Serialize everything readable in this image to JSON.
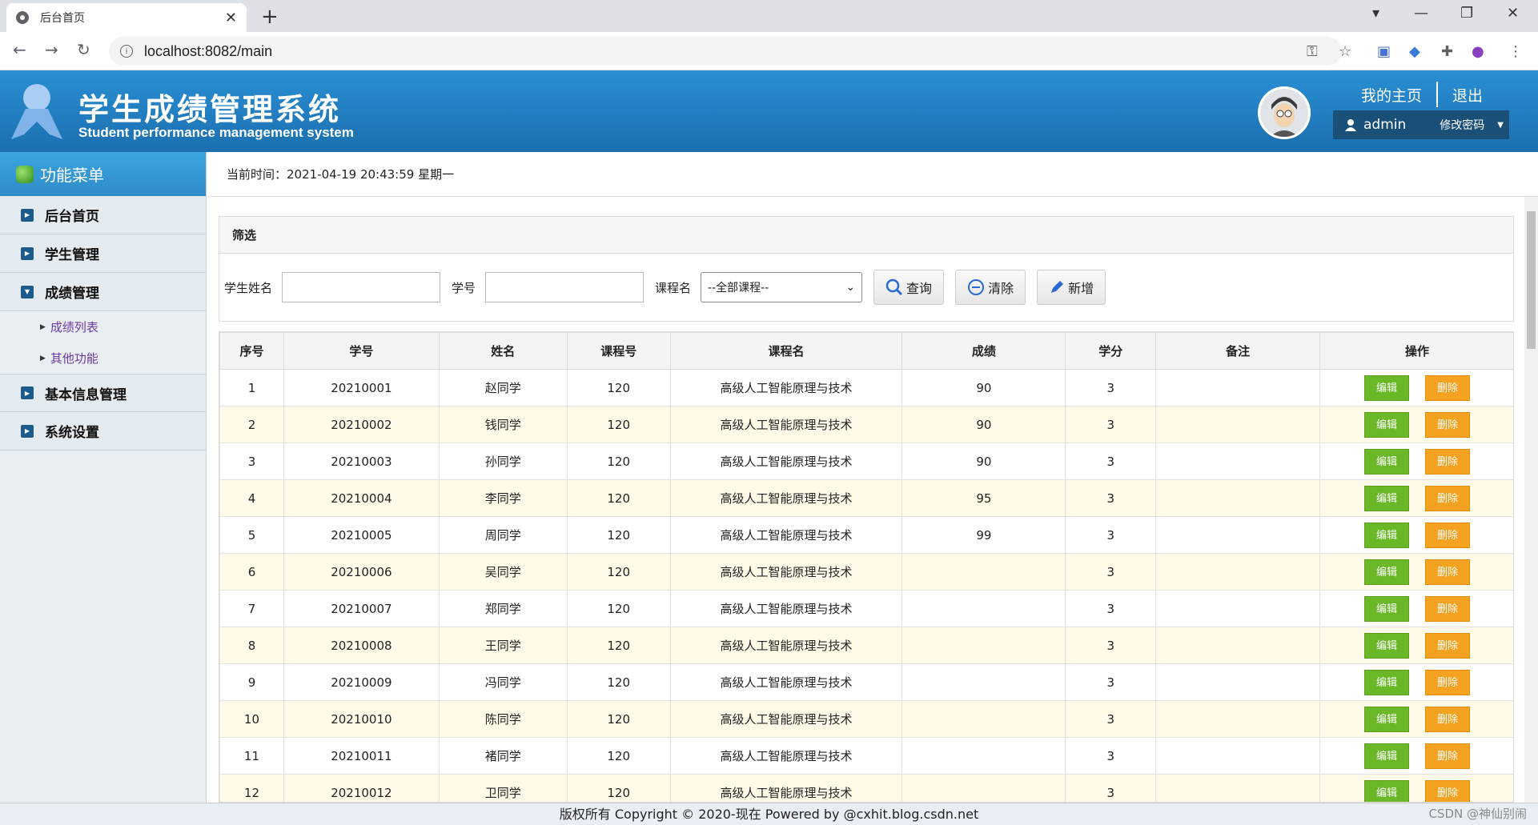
{
  "browser": {
    "tab_title": "后台首页",
    "tab_close": "✕",
    "new_tab": "+",
    "url": "localhost:8082/main"
  },
  "header": {
    "title": "学生成绩管理系统",
    "subtitle": "Student performance management system",
    "home_link": "我的主页",
    "logout_link": "退出",
    "username": "admin",
    "change_password": "修改密码"
  },
  "sidebar": {
    "menu_title": "功能菜单",
    "items": [
      {
        "label": "后台首页"
      },
      {
        "label": "学生管理"
      },
      {
        "label": "成绩管理"
      },
      {
        "label": "基本信息管理"
      },
      {
        "label": "系统设置"
      }
    ],
    "sub_items": [
      {
        "label": "成绩列表"
      },
      {
        "label": "其他功能"
      }
    ]
  },
  "main": {
    "time_label": "当前时间：2021-04-19 20:43:59 星期一",
    "filter_title": "筛选",
    "filter": {
      "name_label": "学生姓名",
      "id_label": "学号",
      "course_label": "课程名",
      "course_selected": "--全部课程--",
      "search_btn": "查询",
      "clear_btn": "清除",
      "add_btn": "新增"
    },
    "table": {
      "columns": [
        "序号",
        "学号",
        "姓名",
        "课程号",
        "课程名",
        "成绩",
        "学分",
        "备注",
        "操作"
      ],
      "edit_label": "编辑",
      "delete_label": "删除",
      "rows": [
        [
          "1",
          "20210001",
          "赵同学",
          "120",
          "高级人工智能原理与技术",
          "90",
          "3",
          ""
        ],
        [
          "2",
          "20210002",
          "钱同学",
          "120",
          "高级人工智能原理与技术",
          "90",
          "3",
          ""
        ],
        [
          "3",
          "20210003",
          "孙同学",
          "120",
          "高级人工智能原理与技术",
          "90",
          "3",
          ""
        ],
        [
          "4",
          "20210004",
          "李同学",
          "120",
          "高级人工智能原理与技术",
          "95",
          "3",
          ""
        ],
        [
          "5",
          "20210005",
          "周同学",
          "120",
          "高级人工智能原理与技术",
          "99",
          "3",
          ""
        ],
        [
          "6",
          "20210006",
          "吴同学",
          "120",
          "高级人工智能原理与技术",
          "",
          "3",
          ""
        ],
        [
          "7",
          "20210007",
          "郑同学",
          "120",
          "高级人工智能原理与技术",
          "",
          "3",
          ""
        ],
        [
          "8",
          "20210008",
          "王同学",
          "120",
          "高级人工智能原理与技术",
          "",
          "3",
          ""
        ],
        [
          "9",
          "20210009",
          "冯同学",
          "120",
          "高级人工智能原理与技术",
          "",
          "3",
          ""
        ],
        [
          "10",
          "20210010",
          "陈同学",
          "120",
          "高级人工智能原理与技术",
          "",
          "3",
          ""
        ],
        [
          "11",
          "20210011",
          "褚同学",
          "120",
          "高级人工智能原理与技术",
          "",
          "3",
          ""
        ],
        [
          "12",
          "20210012",
          "卫同学",
          "120",
          "高级人工智能原理与技术",
          "",
          "3",
          ""
        ]
      ]
    }
  },
  "footer": {
    "copyright": "版权所有 Copyright © 2020-现在 Powered by @cxhit.blog.csdn.net",
    "watermark": "CSDN @神仙别闹"
  },
  "colors": {
    "header_blue": "#1b6fae",
    "edit_green": "#6ab827",
    "delete_orange": "#f5a220",
    "row_alt": "#fffbe8"
  }
}
